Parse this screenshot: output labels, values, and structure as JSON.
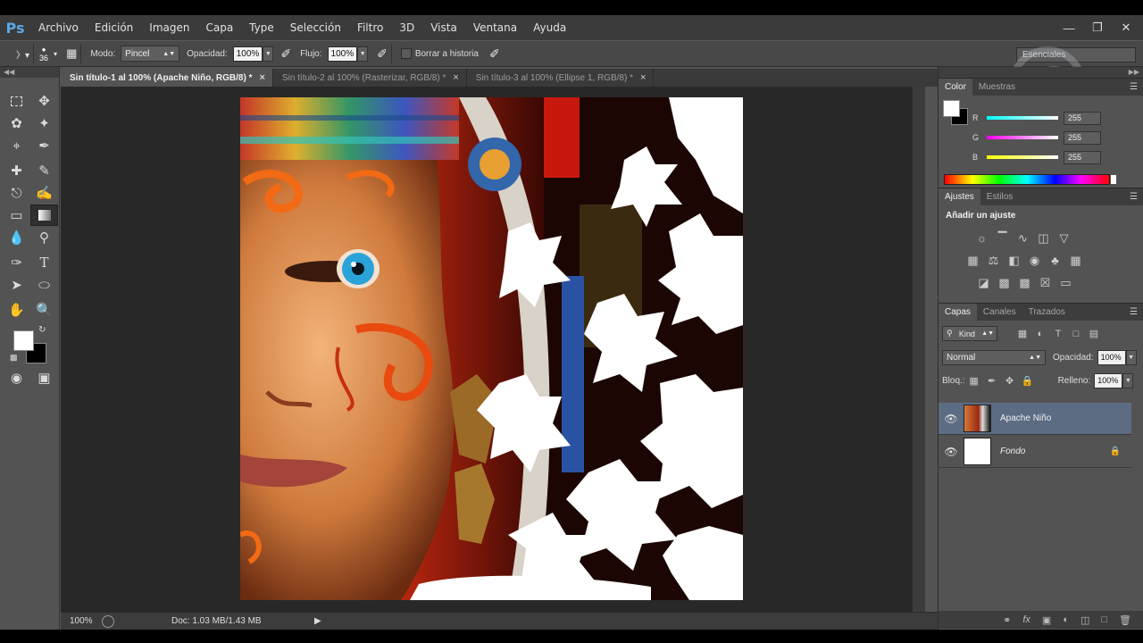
{
  "app": {
    "logo": "Ps"
  },
  "menu": [
    "Archivo",
    "Edición",
    "Imagen",
    "Capa",
    "Type",
    "Selección",
    "Filtro",
    "3D",
    "Vista",
    "Ventana",
    "Ayuda"
  ],
  "window_controls": [
    "minimize-icon",
    "restore-icon",
    "close-icon"
  ],
  "options_bar": {
    "brush_size": "36",
    "mode_label": "Modo:",
    "mode_value": "Pincel",
    "opacity_label": "Opacidad:",
    "opacity_value": "100%",
    "flow_label": "Flujo:",
    "flow_value": "100%",
    "history_label": "Borrar a historia",
    "workspace": "Esenciales"
  },
  "tabs": [
    {
      "label": "Sin título-1 al 100% (Apache Niño, RGB/8) *",
      "active": true
    },
    {
      "label": "Sin título-2 al 100% (Rasterizar, RGB/8) *",
      "active": false
    },
    {
      "label": "Sin título-3 al 100% (Ellipse 1, RGB/8) *",
      "active": false
    }
  ],
  "status": {
    "zoom": "100%",
    "doc": "Doc: 1.03 MB/1.43 MB"
  },
  "color_panel": {
    "tabs": [
      "Color",
      "Muestras"
    ],
    "r_label": "R",
    "r_value": "255",
    "g_label": "G",
    "g_value": "255",
    "b_label": "B",
    "b_value": "255"
  },
  "adjust_panel": {
    "tabs": [
      "Ajustes",
      "Estilos"
    ],
    "title": "Añadir un ajuste"
  },
  "layers_panel": {
    "tabs": [
      "Capas",
      "Canales",
      "Trazados"
    ],
    "kind": "Kind",
    "blend_mode": "Normal",
    "opacity_label": "Opacidad:",
    "opacity_value": "100%",
    "lock_label": "Bloq.:",
    "fill_label": "Relleno:",
    "fill_value": "100%",
    "layers": [
      {
        "name": "Apache Niño",
        "selected": true,
        "locked": false
      },
      {
        "name": "Fondo",
        "selected": false,
        "locked": true
      }
    ]
  },
  "colors": {
    "accent_selected_layer": "#5c6c83",
    "canvas_bg": "#282828",
    "panel": "#535353"
  }
}
